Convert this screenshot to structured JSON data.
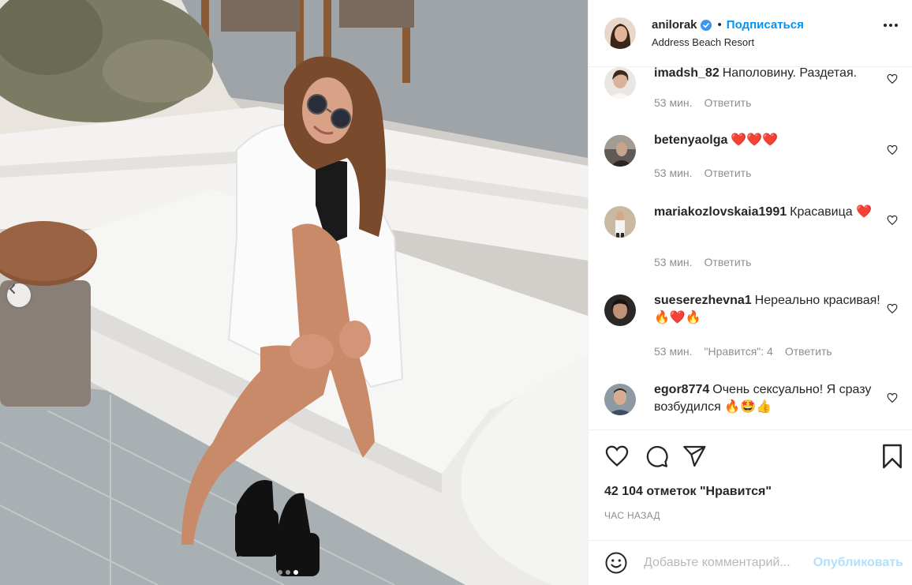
{
  "photo": {
    "alt_icon": "photo",
    "prev_icon": "chevron-left-icon",
    "dots": [
      {
        "active": false
      },
      {
        "active": false
      },
      {
        "active": true
      }
    ]
  },
  "post": {
    "username": "anilorak",
    "verified_icon": "verified-badge-icon",
    "separator": "•",
    "follow_label": "Подписаться",
    "location": "Address Beach Resort",
    "more_icon": "more-options-icon"
  },
  "comments": [
    {
      "user": "imadsh_82",
      "text": "Наполовину. Раздетая.",
      "time": "53 мин.",
      "likes": "",
      "reply": "Ответить"
    },
    {
      "user": "betenyaolga",
      "text": "❤️❤️❤️",
      "time": "53 мин.",
      "likes": "",
      "reply": "Ответить"
    },
    {
      "user": "mariakozlovskaia1991",
      "text": "Красавица ❤️",
      "time": "53 мин.",
      "likes": "",
      "reply": "Ответить"
    },
    {
      "user": "sueserezhevna1",
      "text": "Нереально красивая! 🔥❤️🔥",
      "time": "53 мин.",
      "likes": "\"Нравится\": 4",
      "reply": "Ответить"
    },
    {
      "user": "egor8774",
      "text": "Очень сексуально! Я сразу возбудился 🔥🤩👍",
      "time": "",
      "likes": "",
      "reply": ""
    }
  ],
  "actions": {
    "like_icon": "heart-icon",
    "comment_icon": "comment-icon",
    "share_icon": "send-icon",
    "save_icon": "bookmark-icon"
  },
  "likes_text": "42 104 отметок \"Нравится\"",
  "time_text": "ЧАС НАЗАД",
  "add_comment": {
    "emoji_icon": "emoji-icon",
    "placeholder": "Добавьте комментарий...",
    "publish_label": "Опубликовать"
  },
  "colors": {
    "accent": "#0095f6",
    "publish_disabled": "#b2dffc",
    "muted": "#8e8e8e",
    "text": "#262626",
    "heart": "#e0245e"
  }
}
